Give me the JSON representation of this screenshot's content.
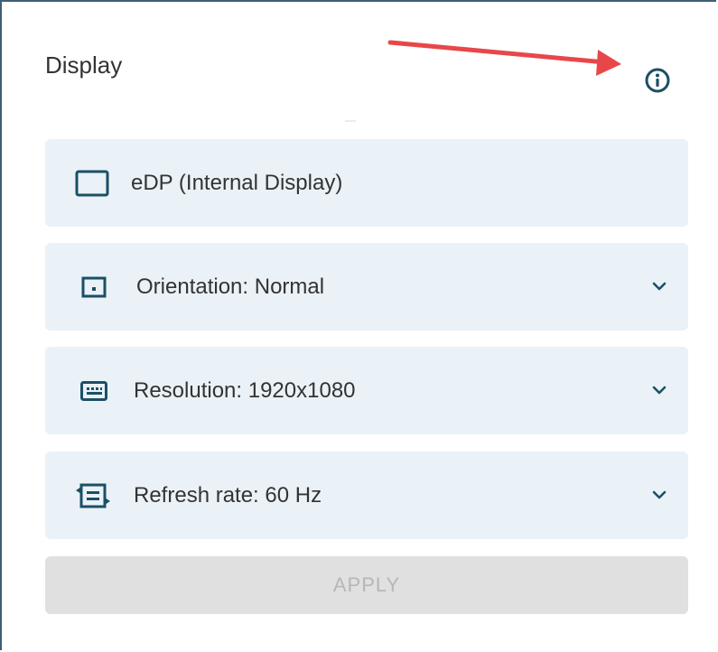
{
  "panel": {
    "title": "Display",
    "info_icon": "info-icon",
    "annotation": "red-arrow"
  },
  "rows": [
    {
      "label": "eDP (Internal Display)",
      "icon": "monitor-icon",
      "expandable": false
    },
    {
      "label": "Orientation: Normal",
      "icon": "orientation-icon",
      "expandable": true
    },
    {
      "label": "Resolution: 1920x1080",
      "icon": "resolution-icon",
      "expandable": true
    },
    {
      "label": "Refresh rate: 60 Hz",
      "icon": "refresh-rate-icon",
      "expandable": true
    }
  ],
  "apply": {
    "label": "APPLY",
    "enabled": false
  },
  "colors": {
    "accent": "#1b4f66",
    "row_background": "#eaf2f7",
    "arrow": "#e8474a",
    "button_disabled_bg": "#e0e0e0",
    "button_disabled_text": "#b7b7b7"
  }
}
